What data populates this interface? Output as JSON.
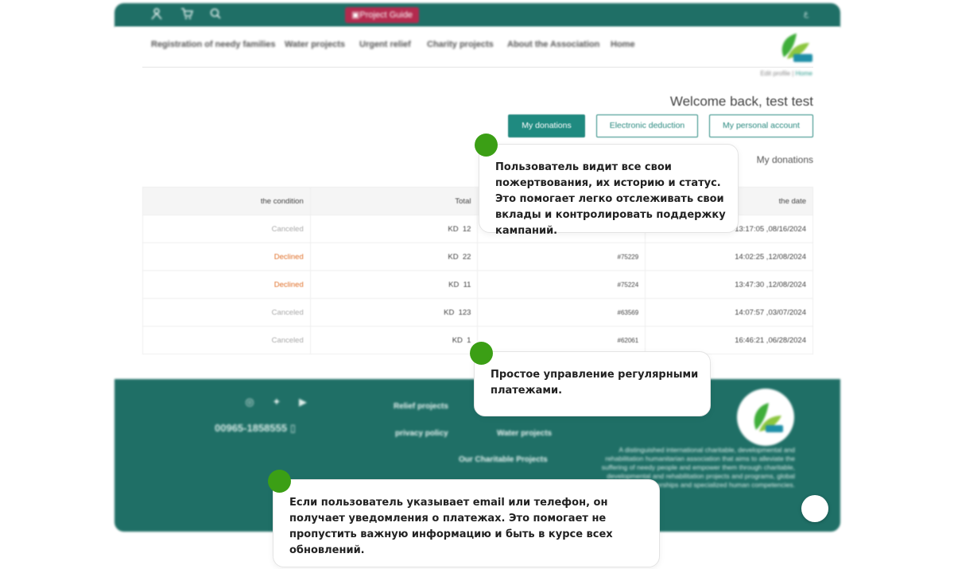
{
  "topbar": {
    "project_guide_label": "Project Guide",
    "lang_label": "ع",
    "icons": [
      "user-icon",
      "cart-icon",
      "search-icon"
    ],
    "bg_color": "#1f6f66"
  },
  "nav": {
    "items": [
      "Registration of needy families",
      "Water projects",
      "Urgent relief",
      "Charity projects",
      "About the Association",
      "Home"
    ]
  },
  "breadcrumb": {
    "current": "Edit profile",
    "separator": "|",
    "home": "Home"
  },
  "welcome": "Welcome back, test test",
  "tabs": {
    "my_donations": "My donations",
    "electronic_deduction": "Electronic deduction",
    "my_personal_account": "My personal account"
  },
  "section_title": "My donations",
  "table": {
    "headers": {
      "condition": "the condition",
      "total": "Total",
      "ref": "",
      "date": "the date"
    },
    "currency": "KD",
    "rows": [
      {
        "condition": "Canceled",
        "amount": "12",
        "ref": "",
        "date": "13:17:05 ,08/16/2024",
        "status": "canceled"
      },
      {
        "condition": "Declined",
        "amount": "22",
        "ref": "#75229",
        "date": "14:02:25 ,12/08/2024",
        "status": "declined"
      },
      {
        "condition": "Declined",
        "amount": "11",
        "ref": "#75224",
        "date": "13:47:30 ,12/08/2024",
        "status": "declined"
      },
      {
        "condition": "Canceled",
        "amount": "123",
        "ref": "#63569",
        "date": "14:07:57 ,03/07/2024",
        "status": "canceled"
      },
      {
        "condition": "Canceled",
        "amount": "1",
        "ref": "#62061",
        "date": "16:46:21 ,06/28/2024",
        "status": "canceled"
      }
    ]
  },
  "footer": {
    "phone": "00965-1858555",
    "links": {
      "relief_projects": "Relief projects",
      "privacy_policy": "privacy policy",
      "water_projects": "Water projects",
      "our_charitable_projects": "Our Charitable Projects"
    },
    "description": "A distinguished international charitable, developmental and rehabilitation humanitarian association that aims to alleviate the suffering of needy people and empower them through charitable, developmental and rehabilitation projects and programs, global strategic partnerships and specialized human competencies.",
    "icons": [
      "instagram-icon",
      "twitter-icon",
      "youtube-icon"
    ]
  },
  "callouts": {
    "donations_history": "Пользователь видит все свои пожертвования, их историю и статус. Это помогает легко отслеживать свои вклады и контролировать поддержку кампаний.",
    "recurring_payments": "Простое управление регулярными платежами.",
    "notifications": "Если пользователь указывает email или телефон, он получает уведомления о платежах. Это помогает не пропустить важную информацию и быть в курсе всех обновлений."
  },
  "colors": {
    "brand_teal": "#1f6f66",
    "button_teal": "#1f8a80",
    "declined": "#e0702a",
    "canceled": "#aaaaaa",
    "callout_dot": "#3b9f15",
    "guide_button": "#b32a4e"
  }
}
